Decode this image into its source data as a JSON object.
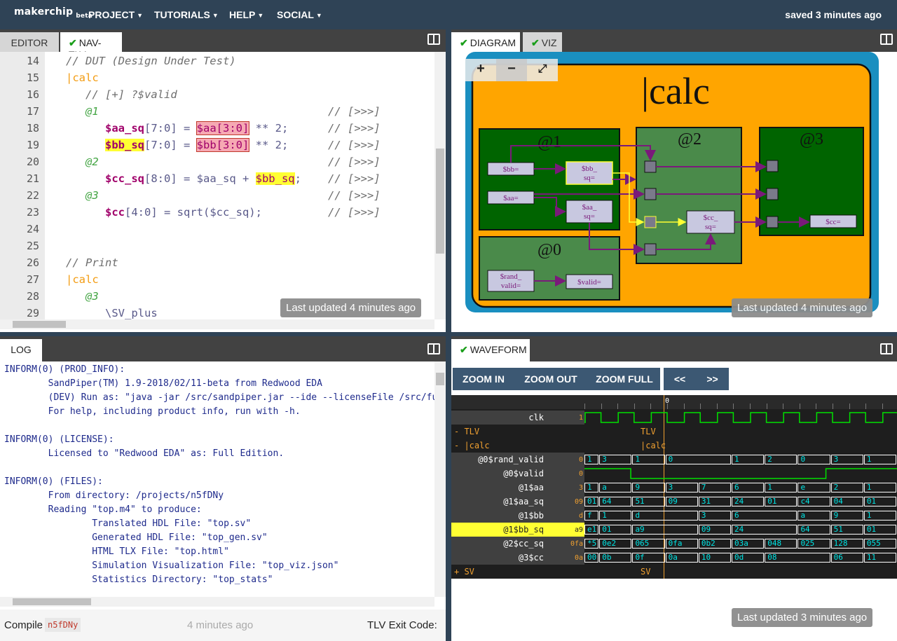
{
  "app": {
    "logo": "makerchip",
    "logo_badge": "beta",
    "saved_status": "saved 3 minutes ago",
    "menu": [
      "PROJECT",
      "TUTORIALS",
      "HELP",
      "SOCIAL"
    ]
  },
  "editor_pane": {
    "tabs": [
      "EDITOR",
      "NAV-TLV"
    ],
    "lines": [
      {
        "n": "14",
        "text": "// DUT (Design Under Test)"
      },
      {
        "n": "15",
        "text": "|calc"
      },
      {
        "n": "16",
        "text": "// [+] ?$valid"
      },
      {
        "n": "17",
        "text": "@1",
        "right": "// [>>>]"
      },
      {
        "n": "18",
        "a": "$aa_sq",
        "b": "[7:0] = ",
        "c": "$aa[3:0]",
        "d": " ** 2;",
        "right": "// [>>>]"
      },
      {
        "n": "19",
        "a": "$bb_sq",
        "b": "[7:0] = ",
        "c": "$bb[3:0]",
        "d": " ** 2;",
        "right": "// [>>>]"
      },
      {
        "n": "20",
        "text": "@2",
        "right": "// [>>>]"
      },
      {
        "n": "21",
        "a": "$cc_sq",
        "b": "[8:0] = $aa_sq + ",
        "c": "$bb_sq",
        "d": ";",
        "right": "// [>>>]"
      },
      {
        "n": "22",
        "text": "@3",
        "right": "// [>>>]"
      },
      {
        "n": "23",
        "a": "$cc",
        "b": "[4:0] = sqrt($cc_sq);",
        "right": "// [>>>]"
      },
      {
        "n": "24",
        "text": ""
      },
      {
        "n": "25",
        "text": ""
      },
      {
        "n": "26",
        "text": "// Print"
      },
      {
        "n": "27",
        "text": "|calc"
      },
      {
        "n": "28",
        "text": "@3"
      },
      {
        "n": "29",
        "text": "\\SV_plus"
      }
    ],
    "last_updated": "Last updated 4 minutes ago"
  },
  "log_pane": {
    "tabs": [
      "LOG"
    ],
    "lines": [
      "INFORM(0) (PROD_INFO):",
      "        SandPiper(TM) 1.9-2018/02/11-beta from Redwood EDA",
      "        (DEV) Run as: \"java -jar /src/sandpiper.jar --ide --licenseFile /src/full_",
      "        For help, including product info, run with -h.",
      "",
      "INFORM(0) (LICENSE):",
      "        Licensed to \"Redwood EDA\" as: Full Edition.",
      "",
      "INFORM(0) (FILES):",
      "        From directory: /projects/n5fDNy",
      "        Reading \"top.m4\" to produce:",
      "                Translated HDL File: \"top.sv\"",
      "                Generated HDL File: \"top_gen.sv\"",
      "                HTML TLX File: \"top.html\"",
      "                Simulation Visualization File: \"top_viz.json\"",
      "                Statistics Directory: \"top_stats\""
    ],
    "compile_label": "Compile",
    "compile_id": "n5fDNy",
    "compile_time": "4 minutes ago",
    "exit_code_label": "TLV Exit Code:"
  },
  "diagram_pane": {
    "tabs": [
      "DIAGRAM",
      "VIZ"
    ],
    "zoom_controls": [
      "+",
      "−",
      "⤢"
    ],
    "title": "|calc",
    "stages": [
      "@1",
      "@2",
      "@3",
      "@0"
    ],
    "nodes": {
      "bb": "$bb=",
      "aa": "$aa=",
      "bb_sq_1": "$bb_",
      "bb_sq_2": "sq=",
      "aa_sq_1": "$aa_",
      "aa_sq_2": "sq=",
      "cc_sq_1": "$cc_",
      "cc_sq_2": "sq=",
      "cc": "$cc=",
      "rand_1": "$rand_",
      "rand_2": "valid=",
      "valid": "$valid="
    },
    "last_updated": "Last updated 4 minutes ago"
  },
  "waveform_pane": {
    "tabs": [
      "WAVEFORM"
    ],
    "buttons": [
      "ZOOM IN",
      "ZOOM OUT",
      "ZOOM FULL",
      "<<",
      ">>"
    ],
    "time_marker": "0",
    "rows": [
      {
        "type": "sig",
        "name": "clk",
        "val": "1",
        "clock": true
      },
      {
        "type": "grp",
        "name": "- TLV",
        "label": "TLV"
      },
      {
        "type": "grp",
        "name": "-   |calc",
        "label": "|calc"
      },
      {
        "type": "sig",
        "name": "@0$rand_valid",
        "val": "0",
        "segs": [
          "1",
          "3",
          "1",
          "0",
          "",
          "1",
          "2",
          "0",
          "3",
          "1"
        ]
      },
      {
        "type": "sig",
        "name": "@0$valid",
        "val": "0",
        "bit": true
      },
      {
        "type": "sig",
        "name": "@1$aa",
        "val": "3",
        "segs": [
          "1",
          "a",
          "9",
          "3",
          "7",
          "6",
          "1",
          "e",
          "2",
          "1"
        ]
      },
      {
        "type": "sig",
        "name": "@1$aa_sq",
        "val": "09",
        "segs": [
          "01",
          "64",
          "51",
          "09",
          "31",
          "24",
          "01",
          "c4",
          "04",
          "01"
        ]
      },
      {
        "type": "sig",
        "name": "@1$bb",
        "val": "d",
        "segs": [
          "f",
          "1",
          "d",
          "",
          "3",
          "6",
          "",
          "a",
          "9",
          "1"
        ]
      },
      {
        "type": "sig",
        "name": "@1$bb_sq",
        "val": "a9",
        "segs": [
          "e1",
          "01",
          "a9",
          "",
          "09",
          "24",
          "",
          "64",
          "51",
          "01"
        ],
        "highlight": true
      },
      {
        "type": "sig",
        "name": "@2$cc_sq",
        "val": "0fa",
        "segs": [
          "*5",
          "0e2",
          "065",
          "0fa",
          "0b2",
          "03a",
          "048",
          "025",
          "128",
          "055"
        ]
      },
      {
        "type": "sig",
        "name": "@3$cc",
        "val": "0a",
        "segs": [
          "00",
          "0b",
          "0f",
          "0a",
          "10",
          "0d",
          "08",
          "",
          "06",
          "11"
        ]
      },
      {
        "type": "grp",
        "name": "+ SV",
        "label": "SV"
      }
    ],
    "last_updated": "Last updated 3 minutes ago"
  },
  "colors": {
    "topbar": "#2f4356",
    "accent_orange": "#f0a030",
    "wave_cyan": "#00e5e5",
    "highlight_yellow": "#ffff33"
  }
}
